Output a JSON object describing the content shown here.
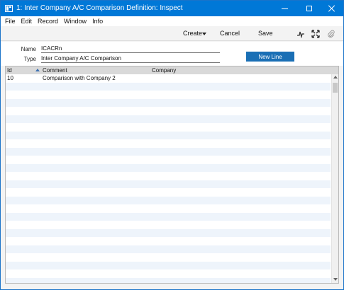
{
  "window": {
    "title": "1: Inter Company A/C Comparison Definition: Inspect"
  },
  "menu": {
    "items": [
      "File",
      "Edit",
      "Record",
      "Window",
      "Info"
    ]
  },
  "toolbar": {
    "create_label": "Create",
    "cancel_label": "Cancel",
    "save_label": "Save",
    "icons": [
      "pulse-icon",
      "expand-icon",
      "paperclip-icon"
    ]
  },
  "form": {
    "name_label": "Name",
    "name_value": "ICACRn",
    "type_label": "Type",
    "type_value": "Inter Company A/C Comparison",
    "new_line_label": "New Line"
  },
  "grid": {
    "columns": [
      "Id",
      "Comment",
      "Company"
    ],
    "sort_column": "Id",
    "rows": [
      [
        "10",
        "Comparison with Company 2",
        ""
      ]
    ]
  },
  "colors": {
    "titlebar": "#0078d7",
    "accent_button": "#1a6fb5",
    "grid_header": "#d9d9d9",
    "row_stripe": "#eef4fb"
  }
}
